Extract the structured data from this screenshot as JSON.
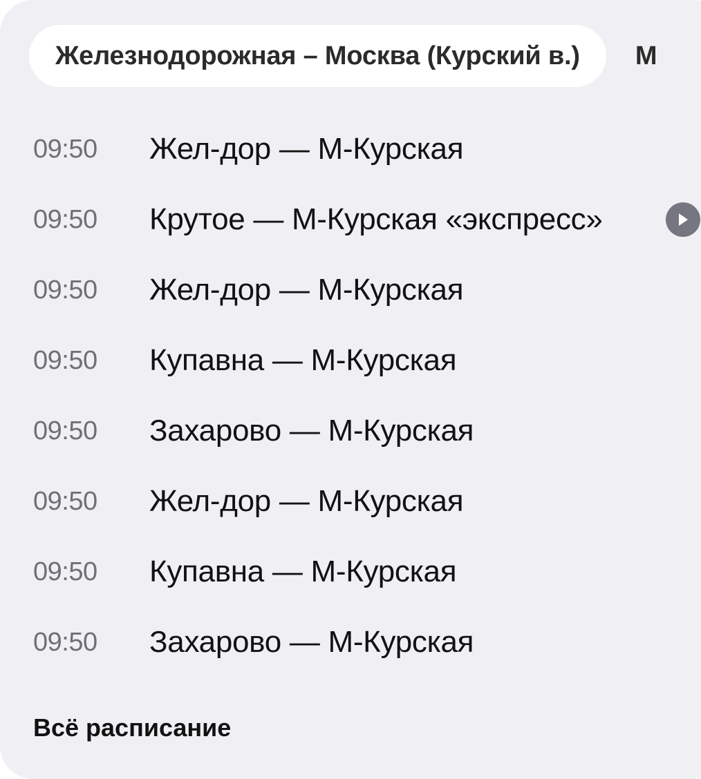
{
  "tabs": {
    "active_label": "Железнодорожная – Москва (Курский в.)",
    "next_label": "М"
  },
  "schedule": {
    "rows": [
      {
        "time": "09:50",
        "route": "Жел-дор — М-Курская"
      },
      {
        "time": "09:50",
        "route": "Крутое — М-Курская «экспресс»",
        "badge_icon": "play-icon"
      },
      {
        "time": "09:50",
        "route": "Жел-дор — М-Курская"
      },
      {
        "time": "09:50",
        "route": "Купавна — М-Курская"
      },
      {
        "time": "09:50",
        "route": "Захарово — М-Курская"
      },
      {
        "time": "09:50",
        "route": "Жел-дор — М-Курская"
      },
      {
        "time": "09:50",
        "route": "Купавна — М-Курская"
      },
      {
        "time": "09:50",
        "route": "Захарово — М-Курская"
      }
    ]
  },
  "footer": {
    "all_schedule_label": "Всё расписание"
  },
  "colors": {
    "card_background": "#f0f0f4",
    "time_text": "#6f6f75",
    "primary_text": "#121212",
    "play_badge": "#757680"
  }
}
